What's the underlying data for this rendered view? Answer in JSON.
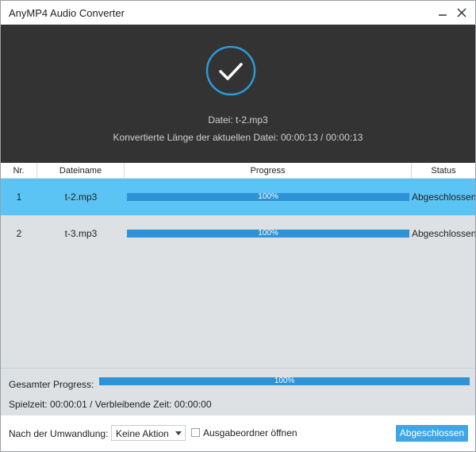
{
  "window": {
    "title": "AnyMP4 Audio Converter"
  },
  "header": {
    "file_line": "Datei: t-2.mp3",
    "length_line": "Konvertierte Länge der aktuellen Datei: 00:00:13 / 00:00:13",
    "icon": "checkmark-circle-icon"
  },
  "table": {
    "columns": [
      "Nr.",
      "Dateiname",
      "Progress",
      "Status"
    ],
    "rows": [
      {
        "nr": "1",
        "name": "t-2.mp3",
        "progress": 1.0,
        "progress_label": "100%",
        "status": "Abgeschlossen",
        "selected": true
      },
      {
        "nr": "2",
        "name": "t-3.mp3",
        "progress": 1.0,
        "progress_label": "100%",
        "status": "Abgeschlossen",
        "selected": false
      }
    ]
  },
  "total": {
    "label": "Gesamter Progress:",
    "progress": 1.0,
    "progress_label": "100%",
    "time_line": "Spielzeit: 00:00:01 / Verbleibende Zeit: 00:00:00"
  },
  "footer": {
    "after_label": "Nach der Umwandlung:",
    "after_value": "Keine Aktion",
    "checkbox_label": "Ausgabeordner öffnen",
    "checkbox_checked": false,
    "done_button": "Abgeschlossen"
  },
  "colors": {
    "header_bg": "#333333",
    "accent": "#3498db",
    "selected_row": "#5bc4f4",
    "list_bg": "#dde1e4"
  }
}
